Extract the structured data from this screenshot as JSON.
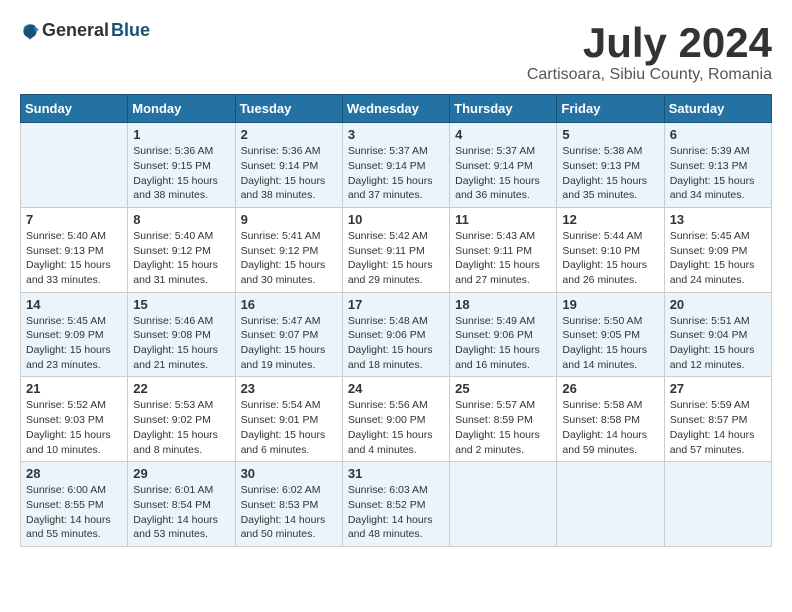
{
  "logo": {
    "general": "General",
    "blue": "Blue"
  },
  "title": {
    "month": "July 2024",
    "location": "Cartisoara, Sibiu County, Romania"
  },
  "calendar": {
    "headers": [
      "Sunday",
      "Monday",
      "Tuesday",
      "Wednesday",
      "Thursday",
      "Friday",
      "Saturday"
    ],
    "weeks": [
      [
        {
          "day": "",
          "sunrise": "",
          "sunset": "",
          "daylight": ""
        },
        {
          "day": "1",
          "sunrise": "Sunrise: 5:36 AM",
          "sunset": "Sunset: 9:15 PM",
          "daylight": "Daylight: 15 hours and 38 minutes."
        },
        {
          "day": "2",
          "sunrise": "Sunrise: 5:36 AM",
          "sunset": "Sunset: 9:14 PM",
          "daylight": "Daylight: 15 hours and 38 minutes."
        },
        {
          "day": "3",
          "sunrise": "Sunrise: 5:37 AM",
          "sunset": "Sunset: 9:14 PM",
          "daylight": "Daylight: 15 hours and 37 minutes."
        },
        {
          "day": "4",
          "sunrise": "Sunrise: 5:37 AM",
          "sunset": "Sunset: 9:14 PM",
          "daylight": "Daylight: 15 hours and 36 minutes."
        },
        {
          "day": "5",
          "sunrise": "Sunrise: 5:38 AM",
          "sunset": "Sunset: 9:13 PM",
          "daylight": "Daylight: 15 hours and 35 minutes."
        },
        {
          "day": "6",
          "sunrise": "Sunrise: 5:39 AM",
          "sunset": "Sunset: 9:13 PM",
          "daylight": "Daylight: 15 hours and 34 minutes."
        }
      ],
      [
        {
          "day": "7",
          "sunrise": "Sunrise: 5:40 AM",
          "sunset": "Sunset: 9:13 PM",
          "daylight": "Daylight: 15 hours and 33 minutes."
        },
        {
          "day": "8",
          "sunrise": "Sunrise: 5:40 AM",
          "sunset": "Sunset: 9:12 PM",
          "daylight": "Daylight: 15 hours and 31 minutes."
        },
        {
          "day": "9",
          "sunrise": "Sunrise: 5:41 AM",
          "sunset": "Sunset: 9:12 PM",
          "daylight": "Daylight: 15 hours and 30 minutes."
        },
        {
          "day": "10",
          "sunrise": "Sunrise: 5:42 AM",
          "sunset": "Sunset: 9:11 PM",
          "daylight": "Daylight: 15 hours and 29 minutes."
        },
        {
          "day": "11",
          "sunrise": "Sunrise: 5:43 AM",
          "sunset": "Sunset: 9:11 PM",
          "daylight": "Daylight: 15 hours and 27 minutes."
        },
        {
          "day": "12",
          "sunrise": "Sunrise: 5:44 AM",
          "sunset": "Sunset: 9:10 PM",
          "daylight": "Daylight: 15 hours and 26 minutes."
        },
        {
          "day": "13",
          "sunrise": "Sunrise: 5:45 AM",
          "sunset": "Sunset: 9:09 PM",
          "daylight": "Daylight: 15 hours and 24 minutes."
        }
      ],
      [
        {
          "day": "14",
          "sunrise": "Sunrise: 5:45 AM",
          "sunset": "Sunset: 9:09 PM",
          "daylight": "Daylight: 15 hours and 23 minutes."
        },
        {
          "day": "15",
          "sunrise": "Sunrise: 5:46 AM",
          "sunset": "Sunset: 9:08 PM",
          "daylight": "Daylight: 15 hours and 21 minutes."
        },
        {
          "day": "16",
          "sunrise": "Sunrise: 5:47 AM",
          "sunset": "Sunset: 9:07 PM",
          "daylight": "Daylight: 15 hours and 19 minutes."
        },
        {
          "day": "17",
          "sunrise": "Sunrise: 5:48 AM",
          "sunset": "Sunset: 9:06 PM",
          "daylight": "Daylight: 15 hours and 18 minutes."
        },
        {
          "day": "18",
          "sunrise": "Sunrise: 5:49 AM",
          "sunset": "Sunset: 9:06 PM",
          "daylight": "Daylight: 15 hours and 16 minutes."
        },
        {
          "day": "19",
          "sunrise": "Sunrise: 5:50 AM",
          "sunset": "Sunset: 9:05 PM",
          "daylight": "Daylight: 15 hours and 14 minutes."
        },
        {
          "day": "20",
          "sunrise": "Sunrise: 5:51 AM",
          "sunset": "Sunset: 9:04 PM",
          "daylight": "Daylight: 15 hours and 12 minutes."
        }
      ],
      [
        {
          "day": "21",
          "sunrise": "Sunrise: 5:52 AM",
          "sunset": "Sunset: 9:03 PM",
          "daylight": "Daylight: 15 hours and 10 minutes."
        },
        {
          "day": "22",
          "sunrise": "Sunrise: 5:53 AM",
          "sunset": "Sunset: 9:02 PM",
          "daylight": "Daylight: 15 hours and 8 minutes."
        },
        {
          "day": "23",
          "sunrise": "Sunrise: 5:54 AM",
          "sunset": "Sunset: 9:01 PM",
          "daylight": "Daylight: 15 hours and 6 minutes."
        },
        {
          "day": "24",
          "sunrise": "Sunrise: 5:56 AM",
          "sunset": "Sunset: 9:00 PM",
          "daylight": "Daylight: 15 hours and 4 minutes."
        },
        {
          "day": "25",
          "sunrise": "Sunrise: 5:57 AM",
          "sunset": "Sunset: 8:59 PM",
          "daylight": "Daylight: 15 hours and 2 minutes."
        },
        {
          "day": "26",
          "sunrise": "Sunrise: 5:58 AM",
          "sunset": "Sunset: 8:58 PM",
          "daylight": "Daylight: 14 hours and 59 minutes."
        },
        {
          "day": "27",
          "sunrise": "Sunrise: 5:59 AM",
          "sunset": "Sunset: 8:57 PM",
          "daylight": "Daylight: 14 hours and 57 minutes."
        }
      ],
      [
        {
          "day": "28",
          "sunrise": "Sunrise: 6:00 AM",
          "sunset": "Sunset: 8:55 PM",
          "daylight": "Daylight: 14 hours and 55 minutes."
        },
        {
          "day": "29",
          "sunrise": "Sunrise: 6:01 AM",
          "sunset": "Sunset: 8:54 PM",
          "daylight": "Daylight: 14 hours and 53 minutes."
        },
        {
          "day": "30",
          "sunrise": "Sunrise: 6:02 AM",
          "sunset": "Sunset: 8:53 PM",
          "daylight": "Daylight: 14 hours and 50 minutes."
        },
        {
          "day": "31",
          "sunrise": "Sunrise: 6:03 AM",
          "sunset": "Sunset: 8:52 PM",
          "daylight": "Daylight: 14 hours and 48 minutes."
        },
        {
          "day": "",
          "sunrise": "",
          "sunset": "",
          "daylight": ""
        },
        {
          "day": "",
          "sunrise": "",
          "sunset": "",
          "daylight": ""
        },
        {
          "day": "",
          "sunrise": "",
          "sunset": "",
          "daylight": ""
        }
      ]
    ]
  }
}
